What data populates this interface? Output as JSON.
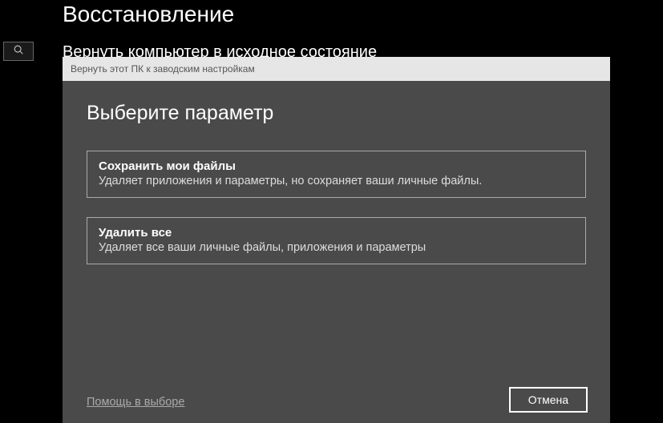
{
  "page": {
    "title": "Восстановление",
    "section_heading": "Вернуть компьютер в исходное состояние"
  },
  "dialog": {
    "titlebar": "Вернуть этот ПК к заводским настройкам",
    "heading": "Выберите параметр",
    "options": [
      {
        "title": "Сохранить мои файлы",
        "desc": "Удаляет приложения и параметры, но сохраняет ваши личные файлы."
      },
      {
        "title": "Удалить все",
        "desc": "Удаляет все ваши личные файлы, приложения и параметры"
      }
    ],
    "help_link": "Помощь в выборе",
    "cancel_label": "Отмена"
  }
}
